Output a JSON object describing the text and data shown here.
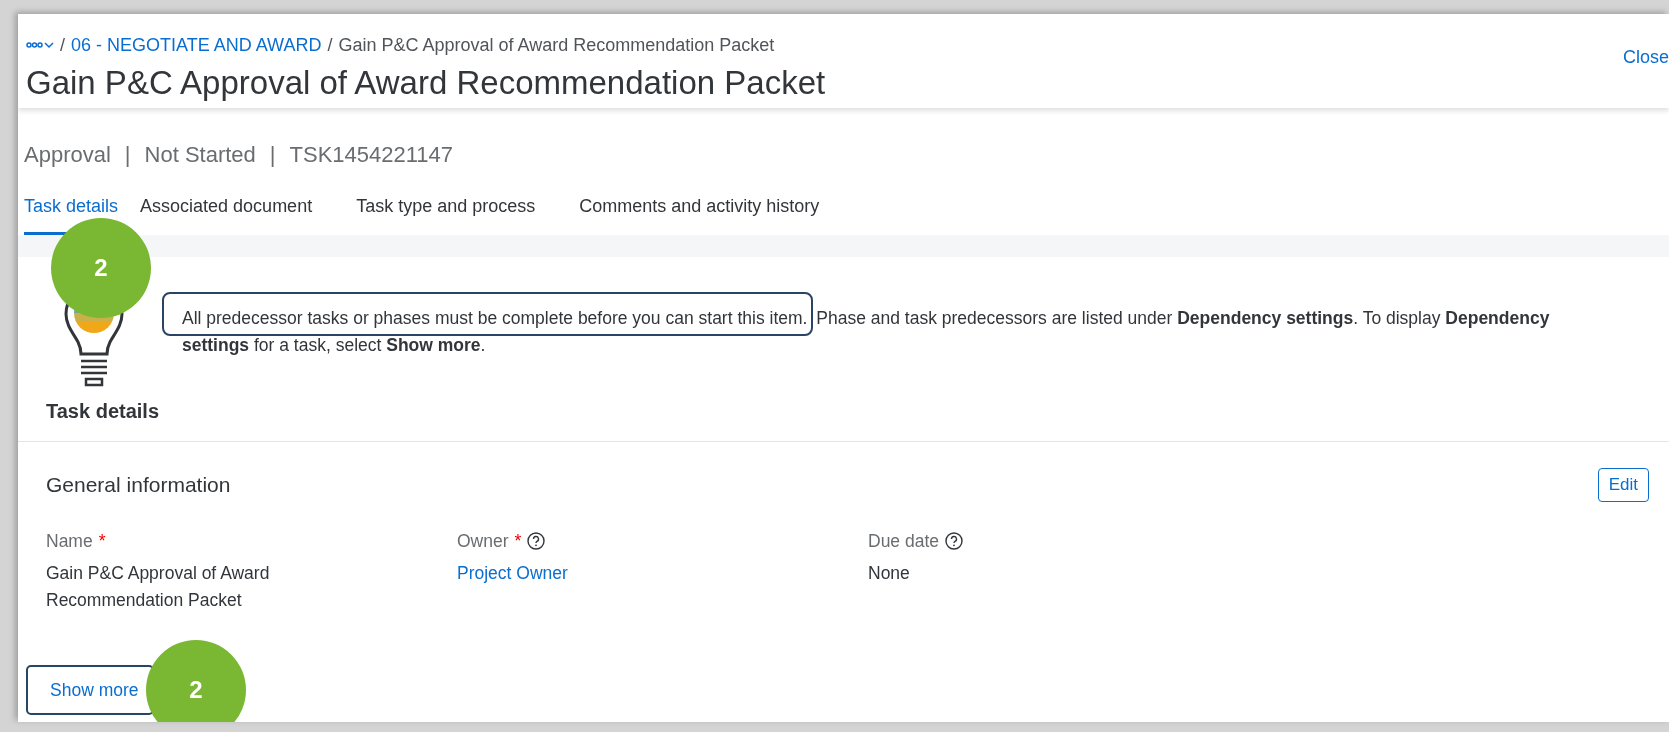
{
  "breadcrumb": {
    "separator": "/",
    "items": [
      {
        "label": "06 - NEGOTIATE AND AWARD",
        "link": true
      },
      {
        "label": "Gain P&C Approval of Award Recommendation Packet",
        "link": false
      }
    ]
  },
  "close_link": "Close",
  "title": "Gain P&C Approval of Award Recommendation Packet",
  "status": {
    "separator": "|",
    "parts": [
      "Approval",
      "Not Started",
      "TSK1454221147"
    ]
  },
  "tabs": [
    {
      "label": "Task details",
      "selected": true
    },
    {
      "label": "Associated document",
      "selected": false
    },
    {
      "label": "Task type and process",
      "selected": false
    },
    {
      "label": "Comments and activity history",
      "selected": false
    }
  ],
  "hint": {
    "highlighted": "All predecessor tasks or phases must be complete before you can start this item.",
    "rest": " Phase and task predecessors are listed under **Dependency settings**. To display **Dependency**",
    "rest_line_2": "**settings** for a task, select **Show more**."
  },
  "section_title": "Task details",
  "general": {
    "title": "General information",
    "edit_button": "Edit",
    "required_mark": "*",
    "fields": [
      {
        "label": "Name",
        "required": true,
        "help": false,
        "value": "Gain P&C Approval of Award Recommendation Packet",
        "kind": "text"
      },
      {
        "label": "Owner",
        "required": true,
        "help": true,
        "value": "Project Owner",
        "kind": "link"
      },
      {
        "label": "Due date",
        "required": false,
        "help": true,
        "value": "None",
        "kind": "text"
      }
    ]
  },
  "show_more": "Show more",
  "callouts": [
    {
      "number": "2"
    },
    {
      "number": "2"
    }
  ]
}
